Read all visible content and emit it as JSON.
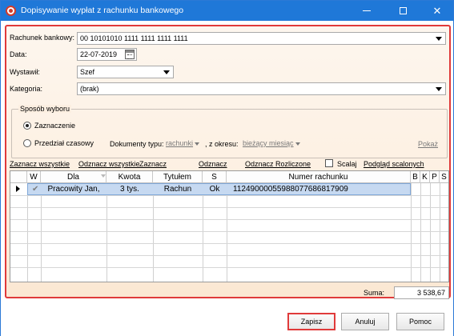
{
  "window": {
    "title": "Dopisywanie wypłat z rachunku bankowego"
  },
  "form": {
    "account_label": "Rachunek bankowy:",
    "account_value": "00 10101010 1111 1111 1111 1111",
    "date_label": "Data:",
    "date_value": "22-07-2019",
    "issuer_label": "Wystawił:",
    "issuer_value": "Szef",
    "category_label": "Kategoria:",
    "category_value": "(brak)"
  },
  "selection": {
    "group_title": "Sposób wyboru",
    "option_marked": "Zaznaczenie",
    "option_range": "Przedział czasowy",
    "selected_option": "Zaznaczenie",
    "doc_type_label": "Dokumenty typu:",
    "doc_type_value": "rachunki",
    "period_label": ", z okresu:",
    "period_value": "bieżący miesiąc",
    "show_link": "Pokaż"
  },
  "actions": {
    "select_all": "Zaznacz wszystkie",
    "deselect_all": "Odznacz wszystkie",
    "select": "Zaznacz",
    "deselect": "Odznacz",
    "deselect_settled": "Odznacz Rozliczone",
    "merge_label": "Scalaj",
    "merge_checked": false,
    "merged_preview": "Podgląd scalonych"
  },
  "table": {
    "columns": [
      "W",
      "Dla",
      "Kwota",
      "Tytułem",
      "S",
      "Numer rachunku",
      "B",
      "K",
      "P",
      "S"
    ],
    "rows": [
      {
        "checked": true,
        "dla": "Pracowity Jan,",
        "kwota": "3 tys.",
        "tytulem": "Rachun",
        "s": "Ok",
        "numer": "11249000055988077686817909"
      }
    ]
  },
  "summary": {
    "sum_label": "Suma:",
    "sum_value": "3 538,67"
  },
  "buttons": {
    "save": "Zapisz",
    "cancel": "Anuluj",
    "help": "Pomoc"
  },
  "colors": {
    "titlebar": "#1f78d8",
    "highlight_border": "#e03a3a",
    "selected_row": "#c6d9f1"
  }
}
